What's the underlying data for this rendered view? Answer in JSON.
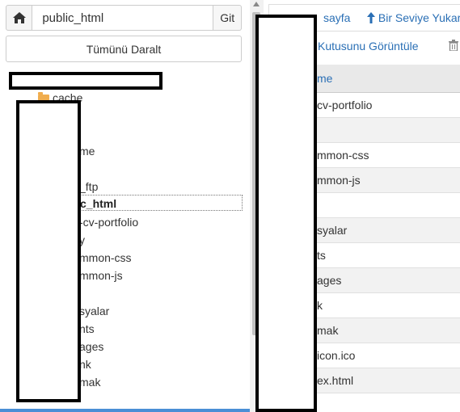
{
  "left_panel": {
    "path_value": "public_html",
    "go_label": "Git",
    "collapse_label": "Tümünü Daralt",
    "tree": [
      {
        "label": "cache",
        "folder": true
      },
      {
        "label": "me",
        "folder": false
      },
      {
        "label": "_ftp",
        "folder": false
      },
      {
        "label": "c_html",
        "folder": false,
        "selected": true
      },
      {
        "label": "-cv-portfolio",
        "folder": false
      },
      {
        "label": "y",
        "folder": false
      },
      {
        "label": "mmon-css",
        "folder": false
      },
      {
        "label": "mmon-js",
        "folder": false
      },
      {
        "label": "syalar",
        "folder": false
      },
      {
        "label": "nts",
        "folder": false
      },
      {
        "label": "ages",
        "folder": false
      },
      {
        "label": "nk",
        "folder": false
      },
      {
        "label": "mak",
        "folder": false
      }
    ]
  },
  "right_panel": {
    "toolbar": {
      "home_link": "sayfa",
      "up_link": "Bir Seviye Yukar",
      "view_link": "Kutusunu Görüntüle"
    },
    "table_header": "me",
    "rows": [
      "cv-portfolio",
      "",
      "mmon-css",
      "mmon-js",
      "",
      "syalar",
      "ts",
      "ages",
      "k",
      "mak",
      "icon.ico",
      "ex.html"
    ]
  }
}
